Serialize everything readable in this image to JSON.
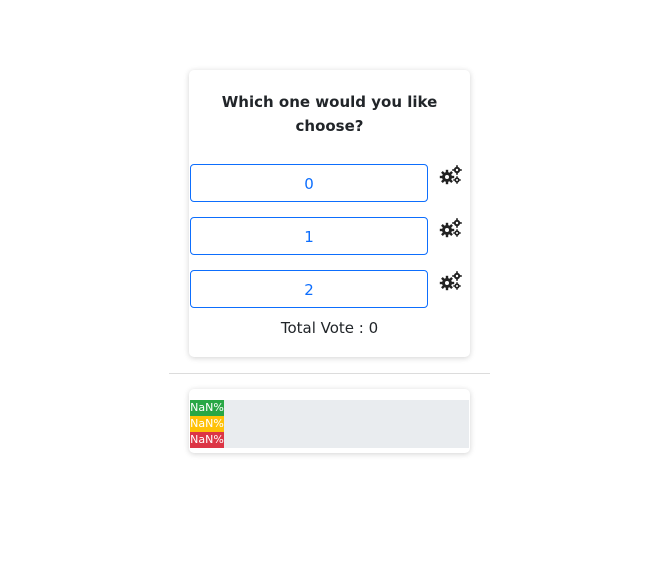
{
  "poll": {
    "question": "Which one would you like choose?",
    "options": [
      {
        "label": "0",
        "icon": "gears-icon"
      },
      {
        "label": "1",
        "icon": "gears-icon"
      },
      {
        "label": "2",
        "icon": "gears-icon"
      }
    ],
    "total_label": "Total Vote : ",
    "total_value": "0"
  },
  "results": {
    "bars": [
      {
        "label": "NaN%",
        "color": "#28a745",
        "fill_fraction": 0
      },
      {
        "label": "NaN%",
        "color": "#ffc107",
        "fill_fraction": 0
      },
      {
        "label": "NaN%",
        "color": "#dc3545",
        "fill_fraction": 0
      }
    ]
  },
  "colors": {
    "accent": "#0d6efd",
    "track": "#e9ecef"
  }
}
